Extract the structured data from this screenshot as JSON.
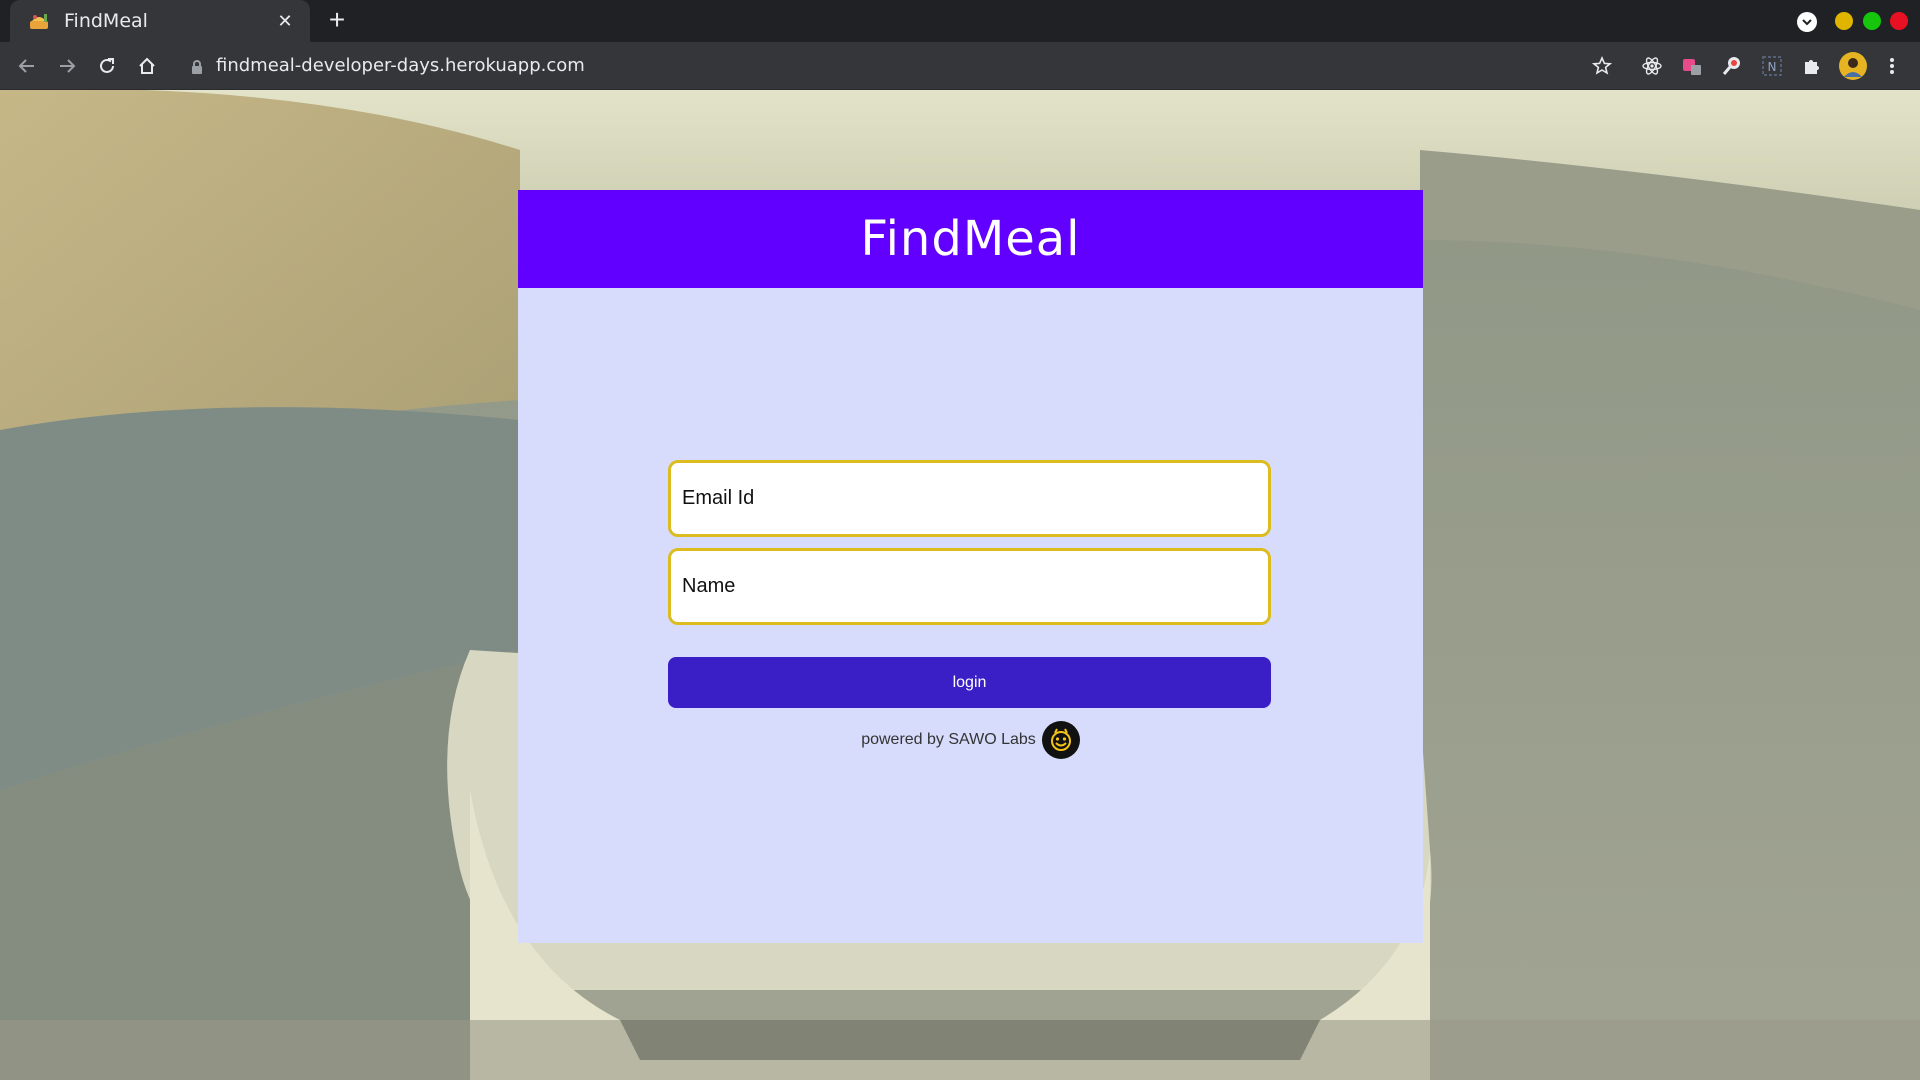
{
  "browser": {
    "tab_title": "FindMeal",
    "tab_close": "✕",
    "new_tab": "+",
    "url": "findmeal-developer-days.herokuapp.com",
    "window_colors": {
      "minimize": "#e0b500",
      "maximize": "#16c60c",
      "close": "#e81123"
    }
  },
  "page": {
    "title": "FindMeal",
    "email_placeholder": "Email Id",
    "name_placeholder": "Name",
    "login_label": "login",
    "powered_by": "powered by SAWO Labs"
  },
  "colors": {
    "header": "#6100ff",
    "card_bg": "#d7dcfc",
    "field_border": "#dcbc1e",
    "button": "#3a1fc7"
  }
}
